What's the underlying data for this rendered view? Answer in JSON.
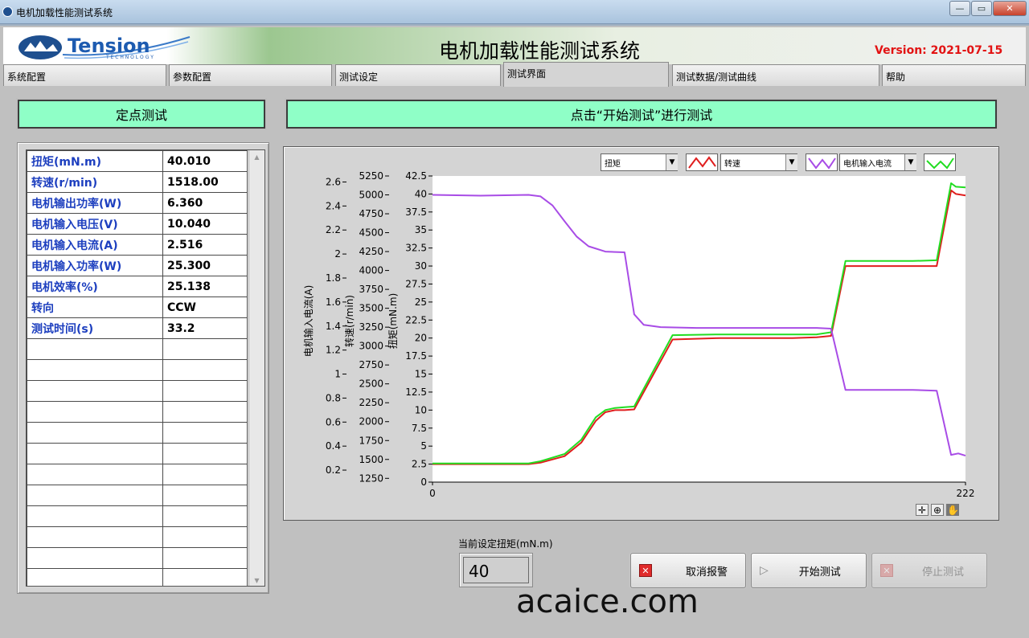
{
  "window": {
    "title": "电机加载性能测试系统",
    "min": "—",
    "max": "▭",
    "close": "✕"
  },
  "header": {
    "brand": "Tension",
    "brand_sub": "T E C H N O L O G Y",
    "title": "电机加载性能测试系统",
    "version": "Version: 2021-07-15"
  },
  "tabs": [
    {
      "label": "系统配置"
    },
    {
      "label": "参数配置"
    },
    {
      "label": "测试设定"
    },
    {
      "label": "测试界面",
      "active": true
    },
    {
      "label": "测试数据/测试曲线"
    },
    {
      "label": "帮助"
    }
  ],
  "left_panel": {
    "title": "定点测试"
  },
  "right_panel": {
    "title": "点击“开始测试”进行测试"
  },
  "table": {
    "rows": [
      {
        "k": "扭矩(mN.m)",
        "v": "40.010"
      },
      {
        "k": "转速(r/min)",
        "v": "1518.00"
      },
      {
        "k": "电机输出功率(W)",
        "v": "6.360"
      },
      {
        "k": "电机输入电压(V)",
        "v": "10.040"
      },
      {
        "k": "电机输入电流(A)",
        "v": "2.516"
      },
      {
        "k": "电机输入功率(W)",
        "v": "25.300"
      },
      {
        "k": "电机效率(%)",
        "v": "25.138"
      },
      {
        "k": "转向",
        "v": "CCW"
      },
      {
        "k": "测试时间(s)",
        "v": "33.2"
      }
    ],
    "empty_rows": 12
  },
  "chart_data": {
    "type": "line",
    "x_range": [
      0,
      222
    ],
    "x_ticks": [
      "0",
      "222"
    ],
    "axes": [
      {
        "label": "电机输入电流(A)",
        "range": [
          0.1,
          2.65
        ],
        "ticks": [
          "0.2",
          "0.4",
          "0.6",
          "0.8",
          "1",
          "1.2",
          "1.4",
          "1.6",
          "1.8",
          "2",
          "2.2",
          "2.4",
          "2.6"
        ]
      },
      {
        "label": "转速(r/min)",
        "range": [
          1200,
          5250
        ],
        "ticks": [
          "1250",
          "1500",
          "1750",
          "2000",
          "2250",
          "2500",
          "2750",
          "3000",
          "3250",
          "3500",
          "3750",
          "4000",
          "4250",
          "4500",
          "4750",
          "5000",
          "5250"
        ]
      },
      {
        "label": "扭矩(mN.m)",
        "range": [
          0,
          42.5
        ],
        "ticks": [
          "0",
          "2.5",
          "5",
          "7.5",
          "10",
          "12.5",
          "15",
          "17.5",
          "20",
          "22.5",
          "25",
          "27.5",
          "30",
          "32.5",
          "35",
          "37.5",
          "40",
          "42.5"
        ]
      }
    ],
    "legend": [
      {
        "name": "扭矩",
        "color": "#e01e1e"
      },
      {
        "name": "转速",
        "color": "#a84ce6"
      },
      {
        "name": "电机输入电流",
        "color": "#22dd22"
      }
    ],
    "series": [
      {
        "name": "扭矩",
        "axis": 2,
        "color": "#e01e1e",
        "x": [
          0,
          20,
          40,
          45,
          55,
          62,
          68,
          72,
          76,
          80,
          84,
          100,
          120,
          140,
          150,
          160,
          166,
          172,
          186,
          200,
          210,
          216,
          218,
          222
        ],
        "y": [
          2.5,
          2.5,
          2.5,
          2.7,
          3.6,
          5.5,
          8.5,
          9.7,
          10.0,
          10.0,
          10.1,
          19.8,
          20.0,
          20.0,
          20.0,
          20.1,
          20.3,
          30.0,
          30.0,
          30.0,
          30.0,
          40.5,
          40.0,
          39.8
        ]
      },
      {
        "name": "电机输入电流",
        "axis": 2,
        "color": "#22dd22",
        "x": [
          0,
          20,
          40,
          45,
          55,
          62,
          68,
          72,
          76,
          80,
          84,
          100,
          120,
          140,
          150,
          160,
          166,
          172,
          186,
          200,
          210,
          216,
          218,
          222
        ],
        "y": [
          2.6,
          2.6,
          2.6,
          2.9,
          3.9,
          5.9,
          9.0,
          10.0,
          10.3,
          10.4,
          10.5,
          20.4,
          20.5,
          20.5,
          20.5,
          20.5,
          20.8,
          30.7,
          30.7,
          30.7,
          30.8,
          41.5,
          41.0,
          40.9
        ]
      },
      {
        "name": "转速",
        "axis": 1,
        "color": "#a84ce6",
        "x": [
          0,
          20,
          40,
          45,
          50,
          55,
          60,
          65,
          72,
          80,
          84,
          88,
          95,
          110,
          140,
          160,
          166,
          172,
          180,
          200,
          210,
          216,
          219,
          222
        ],
        "y": [
          5000,
          4990,
          5000,
          4980,
          4860,
          4650,
          4450,
          4320,
          4250,
          4240,
          3420,
          3280,
          3250,
          3240,
          3240,
          3240,
          3230,
          2420,
          2420,
          2420,
          2410,
          1560,
          1580,
          1550
        ]
      }
    ]
  },
  "setpoint": {
    "label": "当前设定扭矩(mN.m)",
    "value": "40"
  },
  "buttons": {
    "cancel": "取消报警",
    "start": "开始测试",
    "stop": "停止测试"
  },
  "watermark": "acaice.com"
}
